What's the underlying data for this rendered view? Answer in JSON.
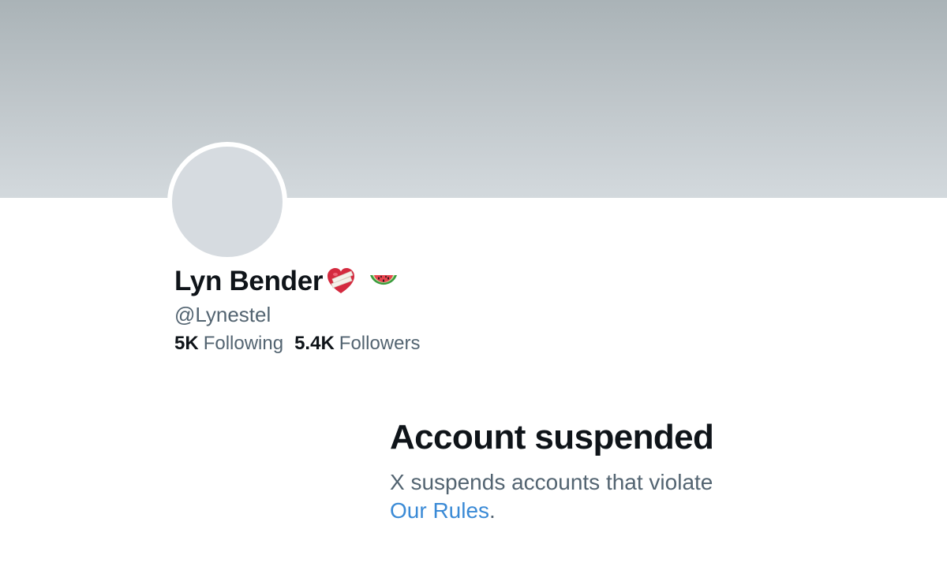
{
  "profile": {
    "display_name": "Lyn Bender",
    "emojis": [
      "heart-with-bandage-icon",
      "watermelon-icon"
    ],
    "handle": "@Lynestel",
    "following_count": "5K",
    "following_label": "Following",
    "followers_count": "5.4K",
    "followers_label": "Followers"
  },
  "suspension": {
    "title": "Account suspended",
    "message_prefix": "X suspends accounts that violate",
    "rules_link": "Our Rules",
    "message_suffix": "."
  },
  "colors": {
    "banner": "#bfc6ca",
    "avatar_placeholder": "#d6dbe0",
    "primary_text": "#0f1419",
    "secondary_text": "#536471",
    "link": "#3a8ad6"
  }
}
